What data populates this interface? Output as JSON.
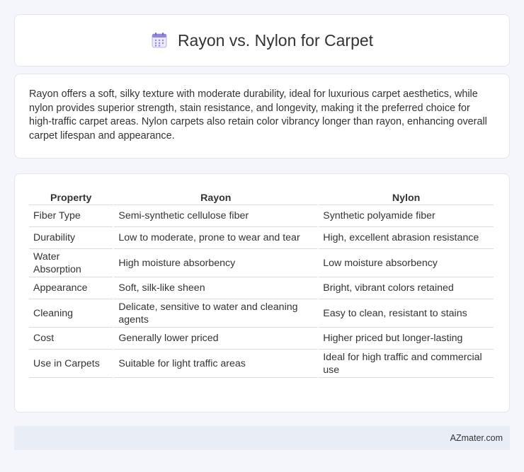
{
  "header": {
    "title": "Rayon vs. Nylon for Carpet",
    "icon": "calendar-icon"
  },
  "description": "Rayon offers a soft, silky texture with moderate durability, ideal for luxurious carpet aesthetics, while nylon provides superior strength, stain resistance, and longevity, making it the preferred choice for high-traffic carpet areas. Nylon carpets also retain color vibrancy longer than rayon, enhancing overall carpet lifespan and appearance.",
  "table": {
    "headers": [
      "Property",
      "Rayon",
      "Nylon"
    ],
    "rows": [
      [
        "Fiber Type",
        "Semi-synthetic cellulose fiber",
        "Synthetic polyamide fiber"
      ],
      [
        "Durability",
        "Low to moderate, prone to wear and tear",
        "High, excellent abrasion resistance"
      ],
      [
        "Water Absorption",
        "High moisture absorbency",
        "Low moisture absorbency"
      ],
      [
        "Appearance",
        "Soft, silk-like sheen",
        "Bright, vibrant colors retained"
      ],
      [
        "Cleaning",
        "Delicate, sensitive to water and cleaning agents",
        "Easy to clean, resistant to stains"
      ],
      [
        "Cost",
        "Generally lower priced",
        "Higher priced but longer-lasting"
      ],
      [
        "Use in Carpets",
        "Suitable for light traffic areas",
        "Ideal for high traffic and commercial use"
      ]
    ]
  },
  "footer": {
    "text": "AZmater.com"
  },
  "colors": {
    "background": "#f4f6fb",
    "card": "#ffffff",
    "footer": "#e9edf6",
    "icon_accent": "#7b6fd6"
  }
}
